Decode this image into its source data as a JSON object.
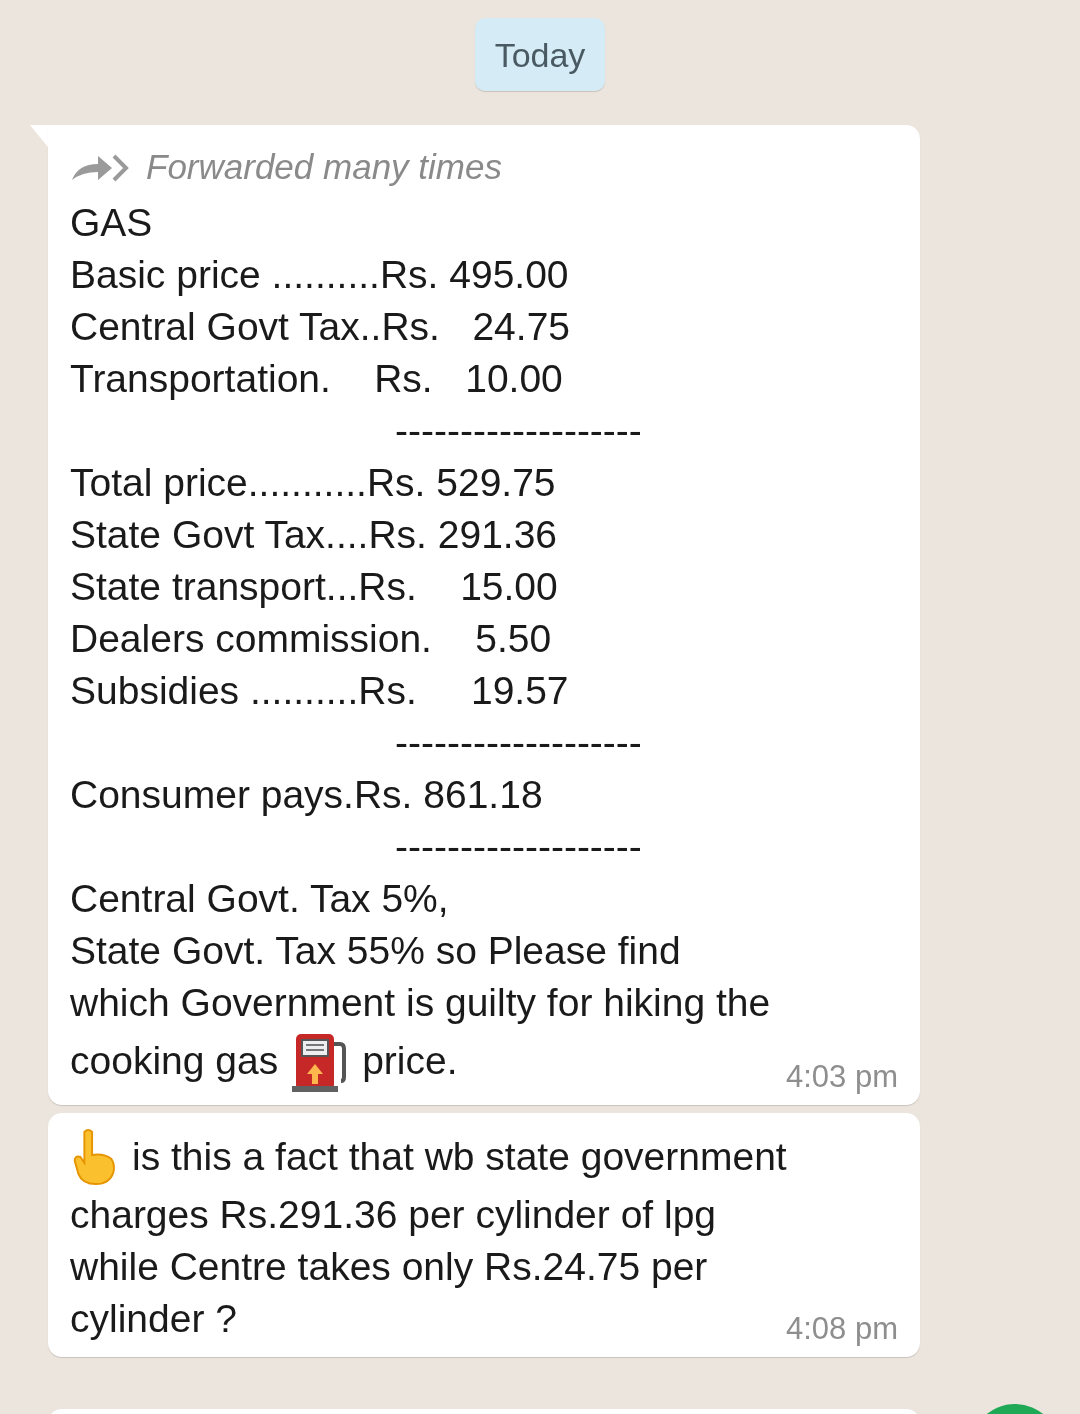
{
  "date_chip": "Today",
  "messages": [
    {
      "kind": "forwarded",
      "forwarded_label": "Forwarded many times",
      "time": "4:03 pm",
      "lines": [
        {
          "text": "GAS"
        },
        {
          "text": "Basic price ..........Rs. 495.00"
        },
        {
          "text": "Central Govt Tax..Rs.   24.75"
        },
        {
          "text": "Transportation.    Rs.   10.00"
        },
        {
          "text": "                              -------------------"
        },
        {
          "text": "Total price...........Rs. 529.75"
        },
        {
          "text": "State Govt Tax....Rs. 291.36"
        },
        {
          "text": "State transport...Rs.    15.00"
        },
        {
          "text": "Dealers commission.    5.50"
        },
        {
          "text": "Subsidies ..........Rs.     19.57"
        },
        {
          "text": "                              -------------------"
        },
        {
          "text": "Consumer pays.Rs. 861.18"
        },
        {
          "text": "                              -------------------"
        },
        {
          "text": "Central Govt. Tax 5%,"
        },
        {
          "text": "State Govt. Tax 55% so Please find"
        },
        {
          "text": "which Government is guilty for hiking the"
        },
        {
          "text": "cooking gas",
          "after": "price."
        }
      ]
    },
    {
      "kind": "pointing",
      "time": "4:08 pm",
      "lines": [
        {
          "text": "is this a fact that wb state government"
        },
        {
          "text": "charges Rs.291.36 per cylinder of lpg"
        },
        {
          "text": "while Centre takes only Rs.24.75 per"
        },
        {
          "text": "cylinder ?"
        }
      ]
    }
  ]
}
